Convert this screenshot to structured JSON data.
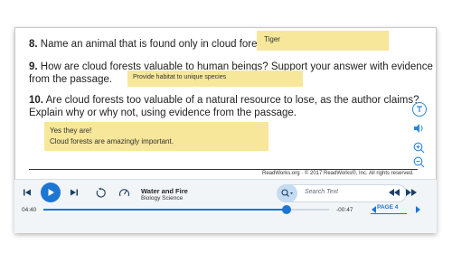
{
  "questions": [
    {
      "number": "8.",
      "text": "Name an animal that is found only in cloud forests.",
      "answer": "Tiger"
    },
    {
      "number": "9.",
      "text_line1": "How are cloud forests valuable to human beings? Support your answer with evidence",
      "text_line2": "from the passage.",
      "answer": "Provide habitat to unique species"
    },
    {
      "number": "10.",
      "text_line1": "Are cloud forests too valuable of a natural resource to lose, as the author claims?",
      "text_line2": "Explain why or why not, using evidence from the passage.",
      "answer_line1": "Yes they are!",
      "answer_line2": "Cloud forests are amazingly important."
    }
  ],
  "footer": {
    "copyright": "ReadWorks.org · © 2017 ReadWorks®, Inc. All rights reserved."
  },
  "player": {
    "title": "Water and Fire",
    "subtitle": "Biology Science",
    "elapsed": "04:40",
    "remaining": "-00:47",
    "progress_fraction": 0.85,
    "search_placeholder": "Search Text",
    "page_label": "PAGE 4"
  },
  "colors": {
    "accent": "#1c76d2",
    "note": "#f7e79a"
  },
  "icons": [
    "text-size-icon",
    "speaker-icon",
    "zoom-in-icon",
    "zoom-out-icon",
    "skip-back-icon",
    "play-icon",
    "skip-forward-icon",
    "replay-icon",
    "speed-icon",
    "search-icon",
    "rewind-icon",
    "fast-forward-icon",
    "page-prev-icon",
    "page-next-icon"
  ]
}
